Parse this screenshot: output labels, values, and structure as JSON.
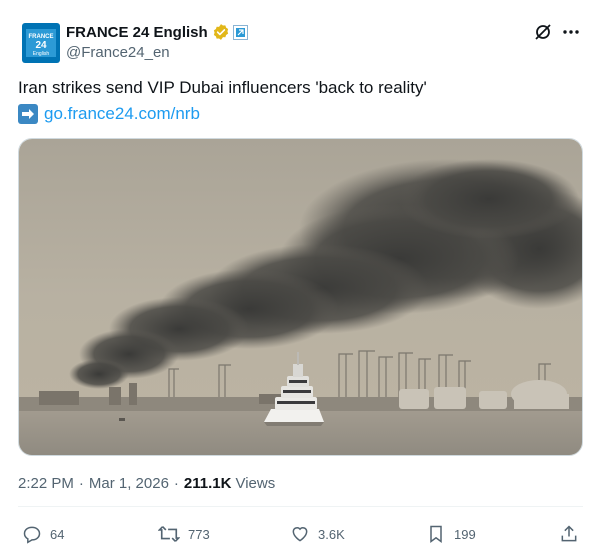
{
  "account": {
    "display_name": "FRANCE 24 English",
    "handle": "@France24_en",
    "avatar_text": "FRANCE 24 English",
    "verified_icon": "gold-verified-badge",
    "affiliate_icon": "affiliate-badge"
  },
  "tweet": {
    "text": "Iran strikes send VIP Dubai influencers 'back to reality'",
    "link_emoji": "right-arrow-emoji",
    "link_text": "go.france24.com/nrb"
  },
  "media": {
    "description_icon": "photo-smoke-over-port-with-yacht"
  },
  "meta": {
    "time": "2:22 PM",
    "separator": "·",
    "date": "Mar 1, 2026",
    "views_count": "211.1K",
    "views_label": "Views"
  },
  "actions": {
    "replies": "64",
    "reposts": "773",
    "likes": "3.6K",
    "bookmarks": "199"
  },
  "colors": {
    "accent": "#1d9bf0",
    "secondary_text": "#536471",
    "verified_gold": "#e2b719",
    "france24_blue": "#0073b4"
  }
}
